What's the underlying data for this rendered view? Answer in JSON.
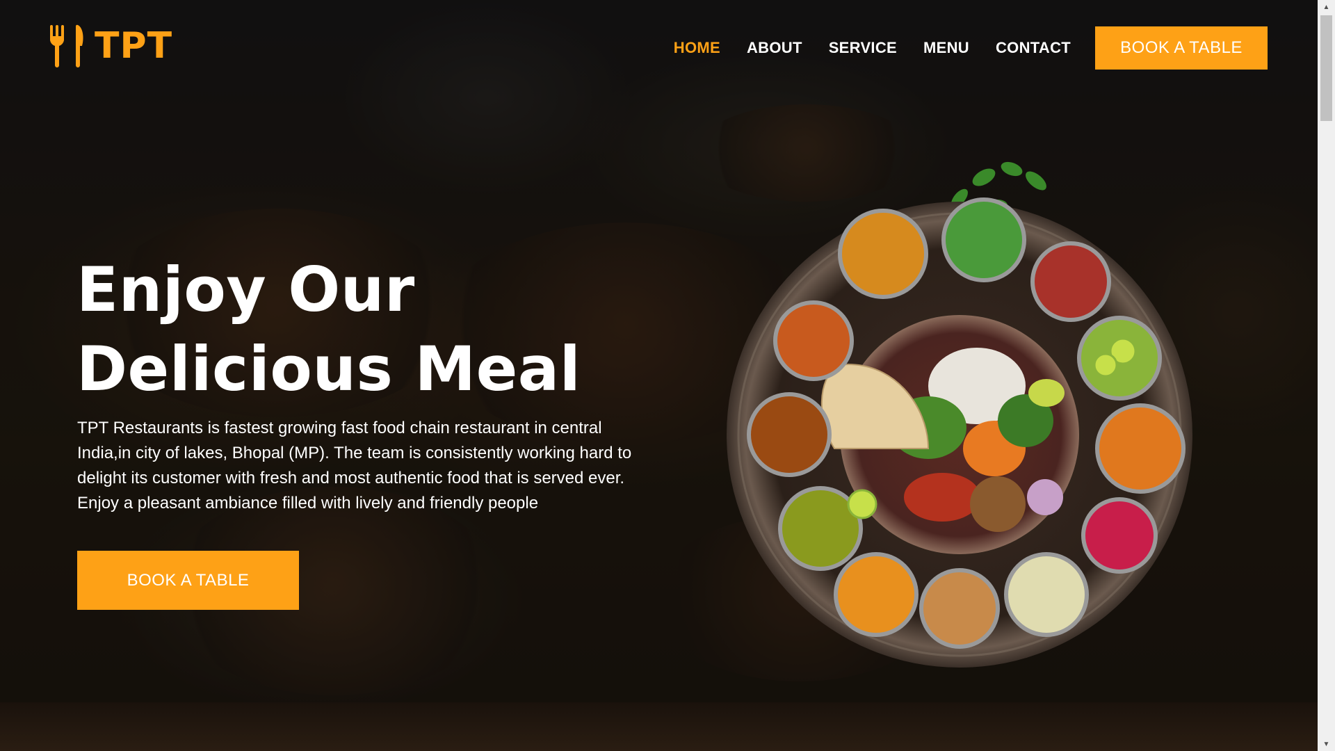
{
  "brand": {
    "name": "TPT",
    "accent_color": "#FEA116",
    "icon": "utensils-icon"
  },
  "nav": {
    "items": [
      {
        "label": "HOME",
        "active": true
      },
      {
        "label": "ABOUT",
        "active": false
      },
      {
        "label": "SERVICE",
        "active": false
      },
      {
        "label": "MENU",
        "active": false
      },
      {
        "label": "CONTACT",
        "active": false
      }
    ],
    "cta_label": "BOOK A TABLE"
  },
  "hero": {
    "title_line1": "Enjoy Our",
    "title_line2": "Delicious Meal",
    "description": "TPT Restaurants is fastest growing fast food chain restaurant in central India,in city of lakes, Bhopal (MP). The team is consistently working hard to delight its customer with fresh and most authentic food that is served ever. Enjoy a pleasant ambiance filled with lively and friendly people",
    "cta_label": "BOOK A TABLE",
    "image": "thali-platter-image"
  },
  "scrollbar": {
    "up_icon": "scroll-up-arrow-icon",
    "down_icon": "scroll-down-arrow-icon"
  }
}
